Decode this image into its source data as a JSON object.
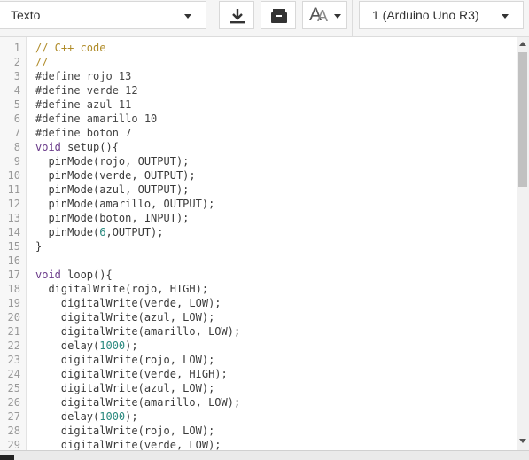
{
  "toolbar": {
    "mode_select": {
      "value": "Texto"
    },
    "download_button": {
      "icon": "download-icon"
    },
    "library_button": {
      "icon": "library-icon"
    },
    "font_size_button": {
      "icon": "font-size-icon",
      "glyph": "A"
    },
    "device_select": {
      "value": "1 (Arduino Uno R3)"
    }
  },
  "editor": {
    "line_numbers": [
      "1",
      "2",
      "3",
      "4",
      "5",
      "6",
      "7",
      "8",
      "9",
      "10",
      "11",
      "12",
      "13",
      "14",
      "15",
      "16",
      "17",
      "18",
      "19",
      "20",
      "21",
      "22",
      "23",
      "24",
      "25",
      "26",
      "27",
      "28",
      "29"
    ],
    "lines": [
      [
        {
          "t": "// C++ code",
          "c": "comment"
        }
      ],
      [
        {
          "t": "//",
          "c": "comment"
        }
      ],
      [
        {
          "t": "#define rojo 13",
          "c": "prep"
        }
      ],
      [
        {
          "t": "#define verde 12",
          "c": "prep"
        }
      ],
      [
        {
          "t": "#define azul 11",
          "c": "prep"
        }
      ],
      [
        {
          "t": "#define amarillo 10",
          "c": "prep"
        }
      ],
      [
        {
          "t": "#define boton 7",
          "c": "prep"
        }
      ],
      [
        {
          "t": "void",
          "c": "kw"
        },
        {
          "t": " setup(){",
          "c": "plain"
        }
      ],
      [
        {
          "t": "  pinMode(rojo, OUTPUT);",
          "c": "plain"
        }
      ],
      [
        {
          "t": "  pinMode(verde, OUTPUT);",
          "c": "plain"
        }
      ],
      [
        {
          "t": "  pinMode(azul, OUTPUT);",
          "c": "plain"
        }
      ],
      [
        {
          "t": "  pinMode(amarillo, OUTPUT);",
          "c": "plain"
        }
      ],
      [
        {
          "t": "  pinMode(boton, INPUT);",
          "c": "plain"
        }
      ],
      [
        {
          "t": "  pinMode(",
          "c": "plain"
        },
        {
          "t": "6",
          "c": "num"
        },
        {
          "t": ",OUTPUT);",
          "c": "plain"
        }
      ],
      [
        {
          "t": "}",
          "c": "plain"
        }
      ],
      [
        {
          "t": "",
          "c": "plain"
        }
      ],
      [
        {
          "t": "void",
          "c": "kw"
        },
        {
          "t": " loop(){",
          "c": "plain"
        }
      ],
      [
        {
          "t": "  digitalWrite(rojo, HIGH);",
          "c": "plain"
        }
      ],
      [
        {
          "t": "    digitalWrite(verde, LOW);",
          "c": "plain"
        }
      ],
      [
        {
          "t": "    digitalWrite(azul, LOW);",
          "c": "plain"
        }
      ],
      [
        {
          "t": "    digitalWrite(amarillo, LOW);",
          "c": "plain"
        }
      ],
      [
        {
          "t": "    delay(",
          "c": "plain"
        },
        {
          "t": "1000",
          "c": "num"
        },
        {
          "t": ");",
          "c": "plain"
        }
      ],
      [
        {
          "t": "    digitalWrite(rojo, LOW);",
          "c": "plain"
        }
      ],
      [
        {
          "t": "    digitalWrite(verde, HIGH);",
          "c": "plain"
        }
      ],
      [
        {
          "t": "    digitalWrite(azul, LOW);",
          "c": "plain"
        }
      ],
      [
        {
          "t": "    digitalWrite(amarillo, LOW);",
          "c": "plain"
        }
      ],
      [
        {
          "t": "    delay(",
          "c": "plain"
        },
        {
          "t": "1000",
          "c": "num"
        },
        {
          "t": ");",
          "c": "plain"
        }
      ],
      [
        {
          "t": "    digitalWrite(rojo, LOW);",
          "c": "plain"
        }
      ],
      [
        {
          "t": "    digitalWrite(verde, LOW);",
          "c": "plain"
        }
      ]
    ]
  },
  "colors": {
    "comment": "#b08c2a",
    "keyword": "#6a3b8a",
    "number": "#2b8a7f"
  }
}
